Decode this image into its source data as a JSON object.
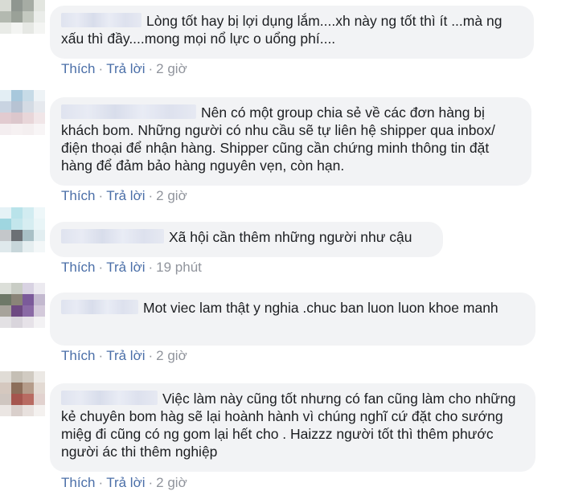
{
  "comments": [
    {
      "text": "Lòng tốt hay bị lợi dụng lắm....xh này ng tốt thì ít ...mà ng xấu thì đầy....mong mọi nổ lực o uổng phí....",
      "like_label": "Thích",
      "reply_label": "Trả lời",
      "time": "2 giờ"
    },
    {
      "text": "Nên có một group chia sẻ về các đơn hàng bị khách bom. Những người có nhu cầu sẽ tự liên hệ shipper qua inbox/ điện thoại để nhận hàng. Shipper cũng cần chứng minh thông tin đặt hàng để đảm bảo hàng nguyên vẹn, còn hạn.",
      "like_label": "Thích",
      "reply_label": "Trả lời",
      "time": "2 giờ"
    },
    {
      "text": "Xã hội cần thêm những người như cậu",
      "like_label": "Thích",
      "reply_label": "Trả lời",
      "time": "19 phút"
    },
    {
      "text": "Mot viec lam thật y nghia .chuc ban luon luon khoe manh",
      "like_label": "Thích",
      "reply_label": "Trả lời",
      "time": "2 giờ"
    },
    {
      "text": "Việc làm này cũng tốt nhưng có fan cũng làm cho những kẻ chuyên bom hàg sẽ lại hoành hành vì chúng nghĩ cứ đặt cho sướng miệg đi cũng có ng gom lại hết cho . Haizzz người tốt thì thêm phước người ác thi thêm nghiệp",
      "like_label": "Thích",
      "reply_label": "Trả lời",
      "time": "2 giờ"
    }
  ],
  "colors": {
    "link": "#4b6fa8",
    "meta": "#90949c",
    "bubble": "#f2f3f5",
    "text": "#1c1e21"
  }
}
